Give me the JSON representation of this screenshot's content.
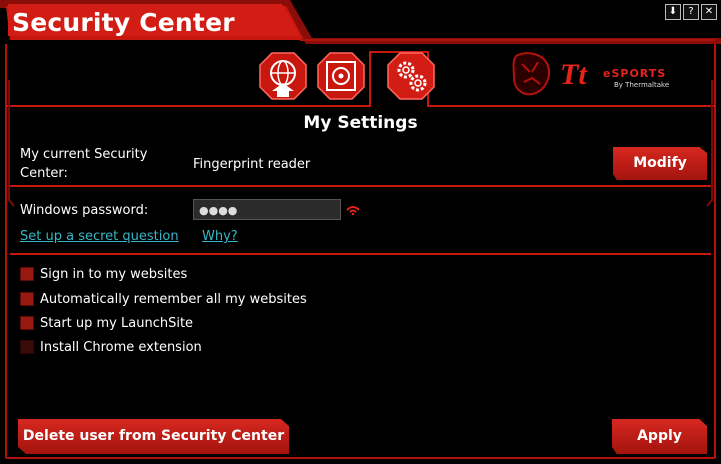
{
  "window": {
    "title": "Security Center",
    "controls": [
      "⬇",
      "?",
      "✕"
    ]
  },
  "tabs": [
    {
      "name": "globe-tab"
    },
    {
      "name": "safe-tab"
    },
    {
      "name": "settings-tab",
      "active": true
    }
  ],
  "brand": {
    "logo_text": "Tt",
    "esports": "eSPORTS",
    "by": "By Thermaltake"
  },
  "section_title": "My Settings",
  "current_security": {
    "label": "My current Security Center:",
    "value": "Fingerprint reader",
    "button": "Modify"
  },
  "password": {
    "label": "Windows password:",
    "value": "●●●●",
    "secret_link": "Set up a secret question",
    "why_link": "Why?"
  },
  "options": [
    {
      "label": "Sign in to my websites",
      "checked": true
    },
    {
      "label": "Automatically remember all my websites",
      "checked": true
    },
    {
      "label": "Start up my LaunchSite",
      "checked": true
    },
    {
      "label": "Install Chrome extension",
      "checked": false
    }
  ],
  "footer": {
    "delete_button": "Delete user from Security Center",
    "apply_button": "Apply"
  },
  "colors": {
    "accent": "#e5231b",
    "link": "#39b6c7",
    "background": "#000000"
  }
}
